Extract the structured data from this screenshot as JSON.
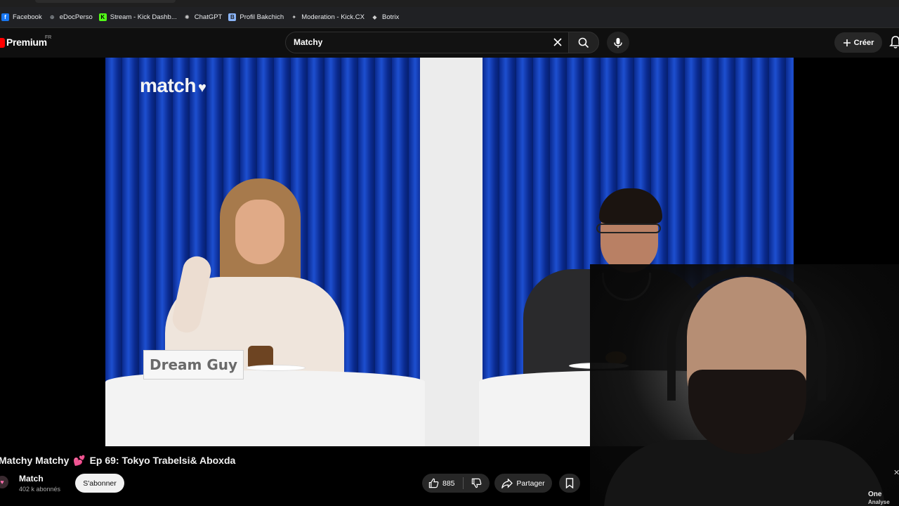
{
  "bookmarks": [
    {
      "label": "Facebook",
      "icon": "facebook-icon",
      "color": "#1877f2",
      "glyph": "f"
    },
    {
      "label": "eDocPerso",
      "icon": "globe-icon",
      "color": "#9aa0a6",
      "glyph": "⊕"
    },
    {
      "label": "Stream - Kick Dashb...",
      "icon": "kick-icon",
      "color": "#53fc18",
      "glyph": "K"
    },
    {
      "label": "ChatGPT",
      "icon": "chatgpt-icon",
      "color": "#cfcfcf",
      "glyph": "✺"
    },
    {
      "label": "Profil Bakchich",
      "icon": "bakchich-icon",
      "color": "#8ab4f8",
      "glyph": "B"
    },
    {
      "label": "Moderation - Kick.CX",
      "icon": "moderation-icon",
      "color": "#cfcfcf",
      "glyph": "✦"
    },
    {
      "label": "Botrix",
      "icon": "botrix-icon",
      "color": "#cfcfcf",
      "glyph": "◆"
    }
  ],
  "header": {
    "logo_text": "Premium",
    "region": "FR",
    "search_value": "Matchy",
    "create_label": "Créer"
  },
  "video": {
    "brand": "match",
    "name_card": "Dream Guy"
  },
  "info": {
    "title_prefix": "Matchy Matchy",
    "title_emoji": "💕",
    "title_rest": "Ep 69: Tokyo Trabelsi& Aboxda",
    "channel_name": "Match",
    "subscribers": "402 k abonnés",
    "subscribe_label": "S'abonner",
    "likes": "885",
    "share_label": "Partager"
  },
  "overlay": {
    "corner_line1": "One",
    "corner_line2": "Analyse"
  },
  "colors": {
    "accent": "#ff0000",
    "background": "#0f0f0f",
    "pill": "#272727"
  }
}
